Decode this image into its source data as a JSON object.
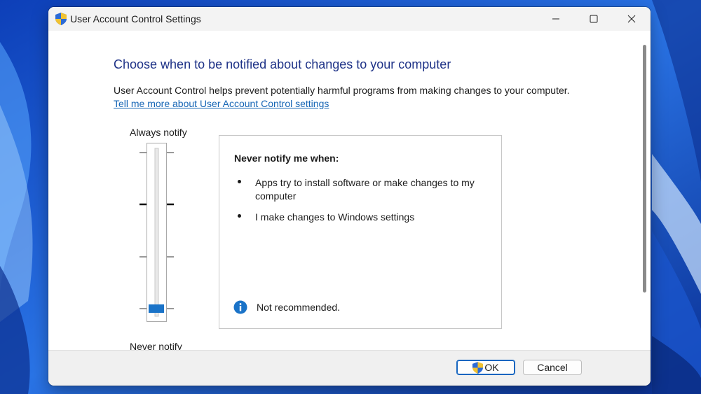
{
  "window": {
    "title": "User Account Control Settings",
    "controls": {
      "minimize": "minimize-icon",
      "maximize": "maximize-icon",
      "close": "close-icon"
    }
  },
  "main": {
    "heading": "Choose when to be notified about changes to your computer",
    "description": "User Account Control helps prevent potentially harmful programs from making changes to your computer.",
    "learn_more_link": "Tell me more about User Account Control settings",
    "slider": {
      "top_label": "Always notify",
      "bottom_label": "Never notify",
      "levels": 4,
      "selected_level": 1
    },
    "panel": {
      "title": "Never notify me when:",
      "items": [
        "Apps try to install software or make changes to my computer",
        "I make changes to Windows settings"
      ],
      "note": "Not recommended."
    }
  },
  "footer": {
    "ok_label": "OK",
    "cancel_label": "Cancel"
  },
  "colors": {
    "heading": "#1e3287",
    "link": "#1565b5",
    "slider_thumb": "#1a73c8",
    "info_icon": "#1a73c8",
    "wallpaper": "#1f5fd6"
  }
}
